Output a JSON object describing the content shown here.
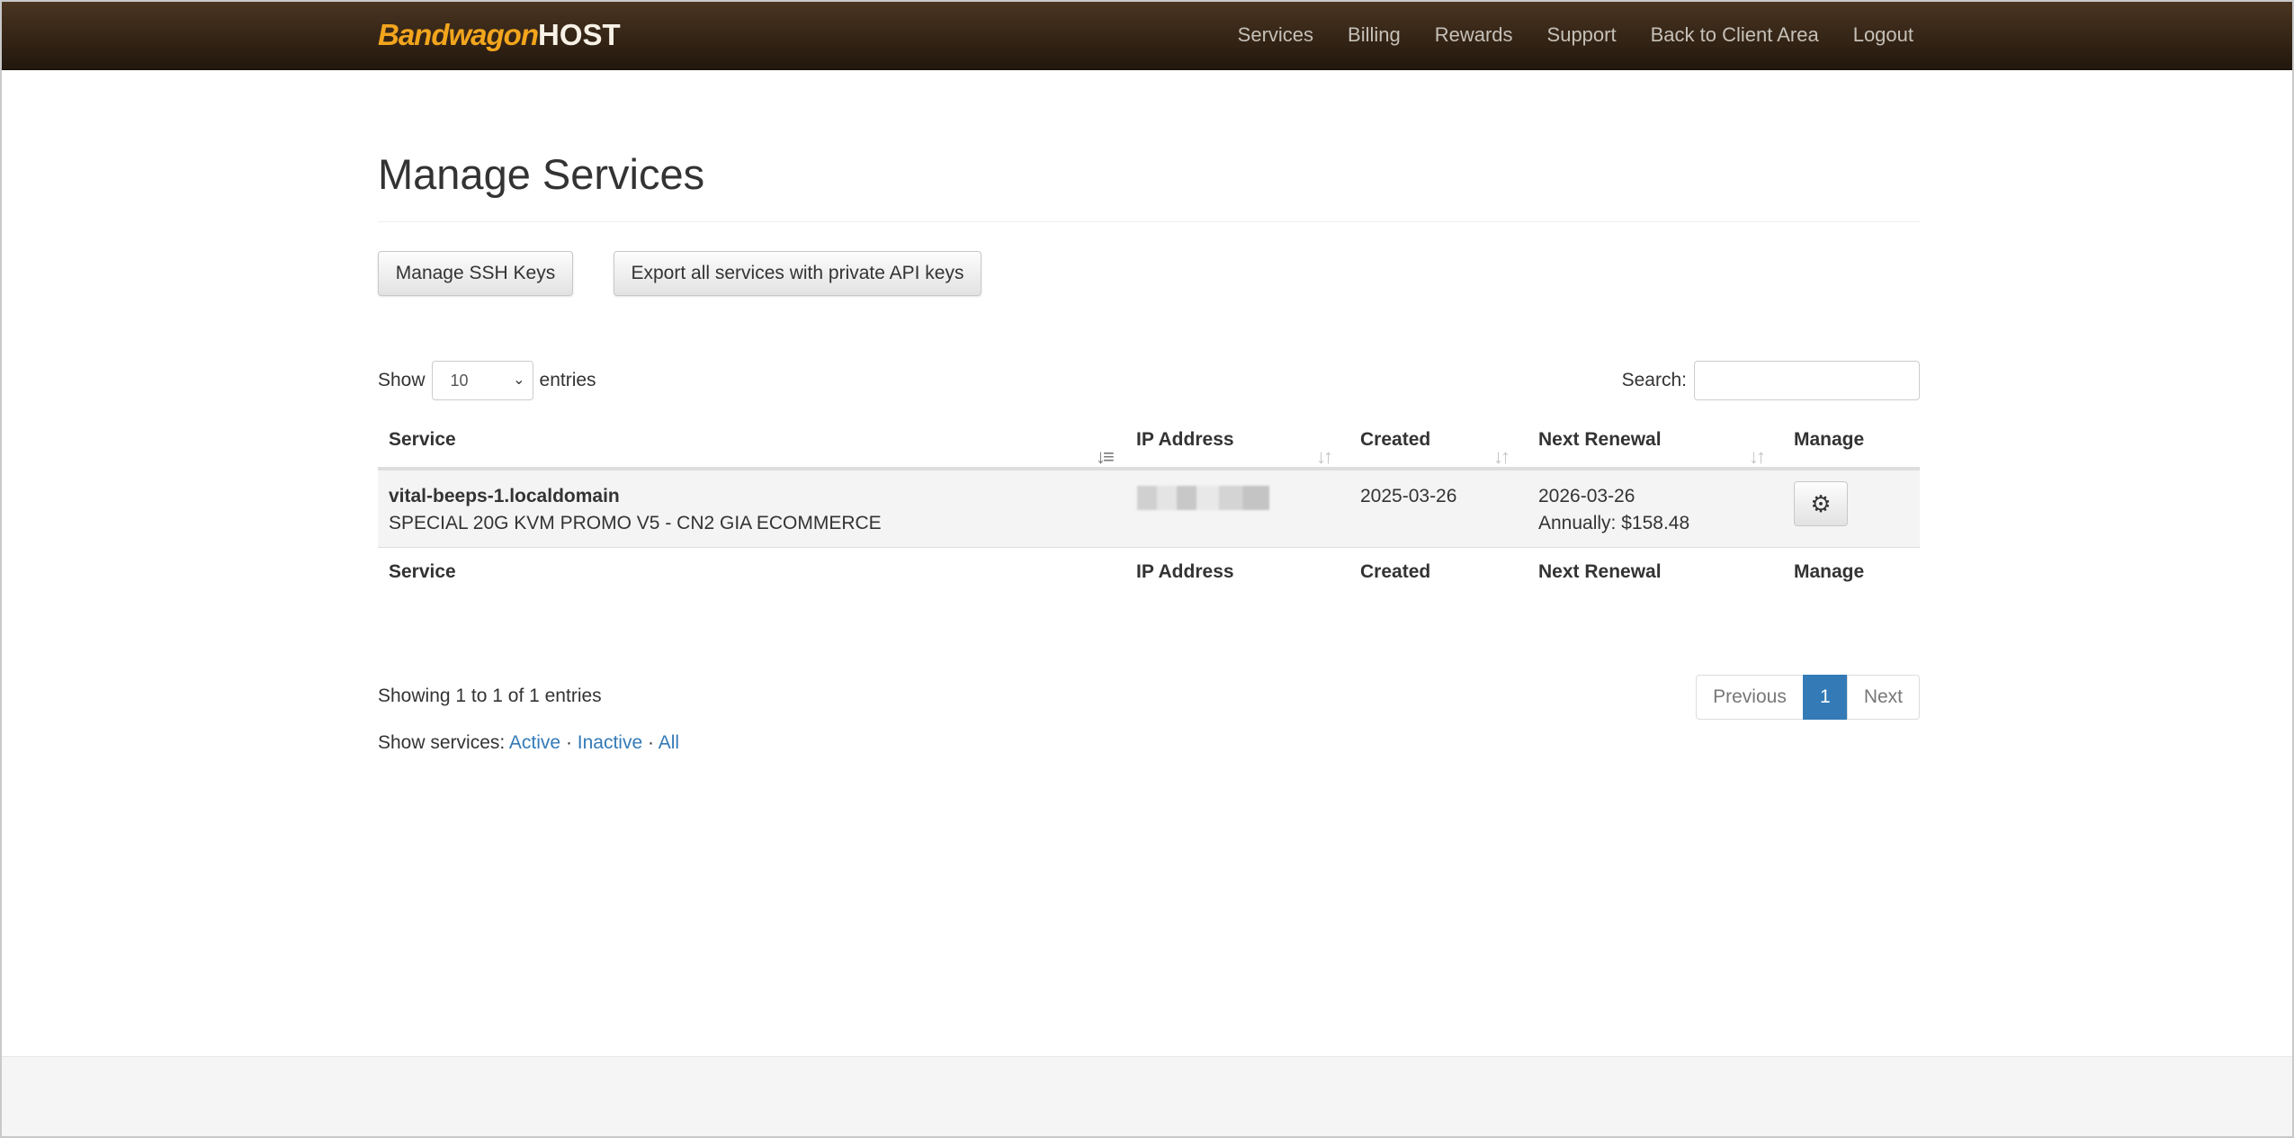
{
  "navbar": {
    "brand_part1": "Bandwagon",
    "brand_part2": "HOST",
    "links": [
      "Services",
      "Billing",
      "Rewards",
      "Support",
      "Back to Client Area",
      "Logout"
    ]
  },
  "page": {
    "title": "Manage Services",
    "buttons": {
      "ssh_keys": "Manage SSH Keys",
      "export": "Export all services with private API keys"
    }
  },
  "table_controls": {
    "show_label": "Show",
    "entries_label": "entries",
    "page_length": "10",
    "search_label": "Search:",
    "search_value": ""
  },
  "table": {
    "columns": [
      "Service",
      "IP Address",
      "Created",
      "Next Renewal",
      "Manage"
    ],
    "rows": [
      {
        "service_name": "vital-beeps-1.localdomain",
        "service_plan": "SPECIAL 20G KVM PROMO V5 - CN2 GIA ECOMMERCE",
        "created": "2025-03-26",
        "next_renewal_date": "2026-03-26",
        "next_renewal_price": "Annually: $158.48"
      }
    ]
  },
  "table_info": "Showing 1 to 1 of 1 entries",
  "pagination": {
    "previous": "Previous",
    "current_page": "1",
    "next": "Next"
  },
  "filter": {
    "label": "Show services:",
    "options": [
      "Active",
      "Inactive",
      "All"
    ],
    "separator": "·"
  },
  "icons": {
    "sort": "sort-icon",
    "gear": "gear-icon",
    "chevron": "chevron-down-icon"
  },
  "colors": {
    "navbar_top": "#4a3521",
    "navbar_bottom": "#22170d",
    "brand_orange": "#f2a51d",
    "link_blue": "#337ab7",
    "active_page_bg": "#337ab7"
  }
}
